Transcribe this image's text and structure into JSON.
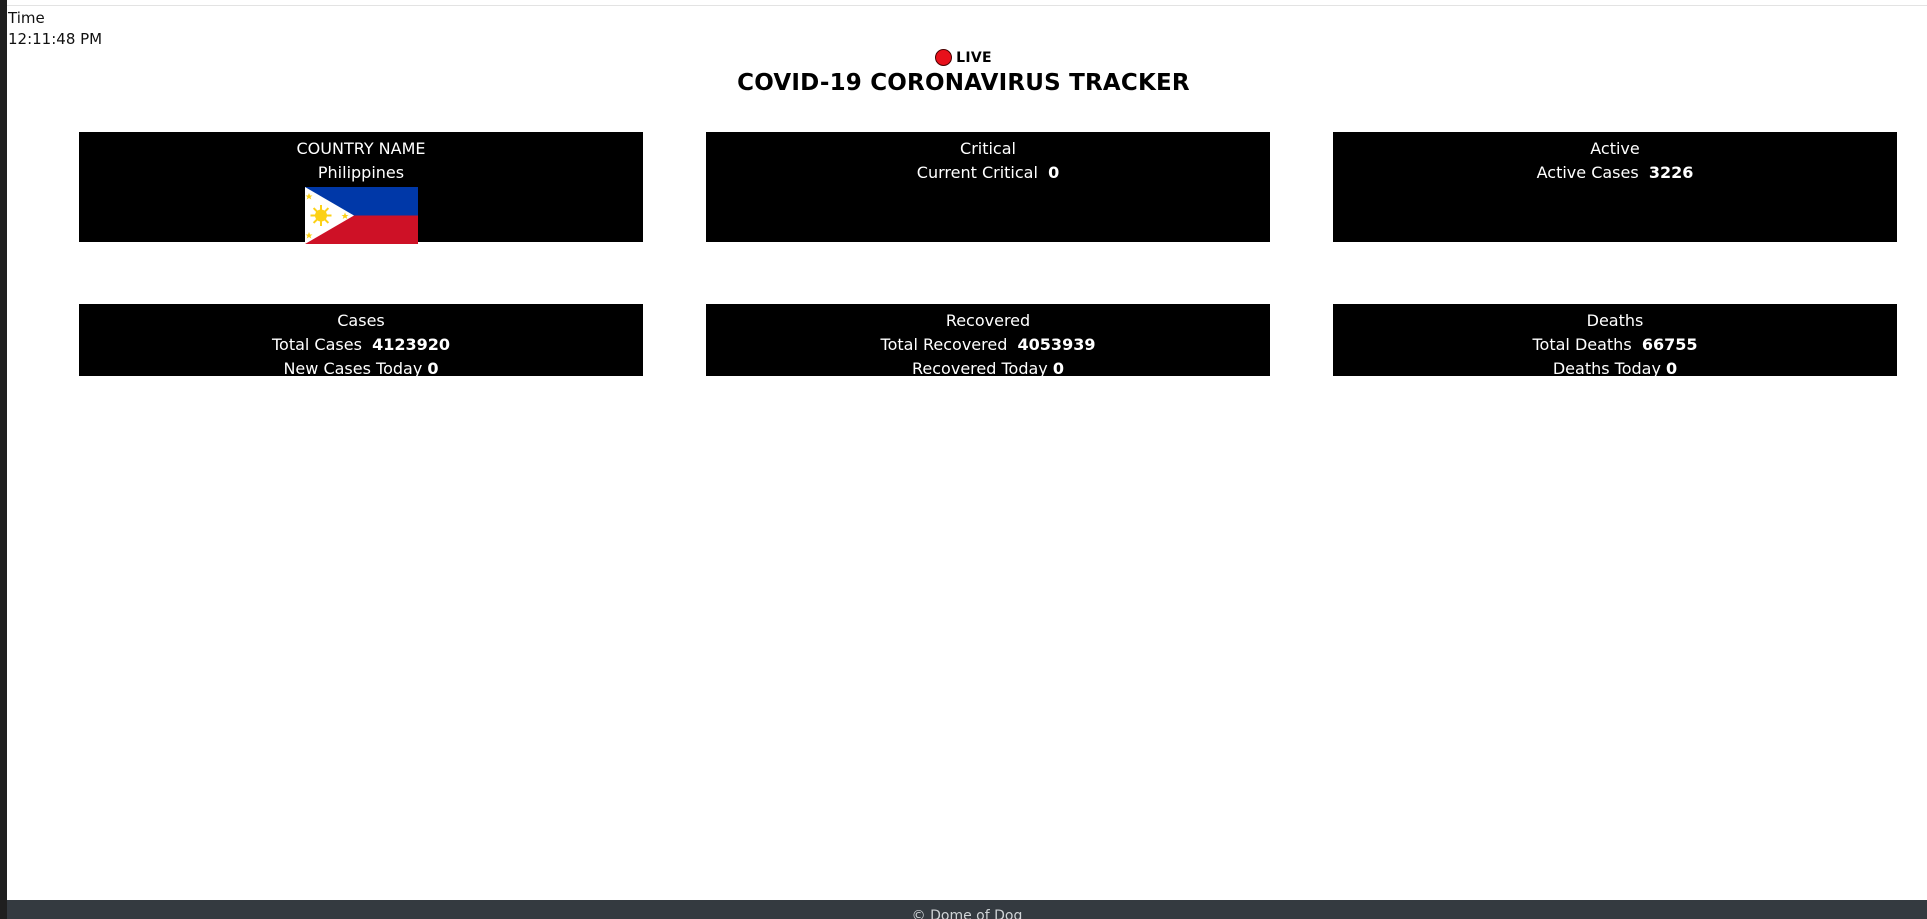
{
  "header": {
    "time_label": "Time",
    "time_value": "12:11:48 PM",
    "live_label": "LIVE",
    "title": "COVID-19 CORONAVIRUS TRACKER"
  },
  "colors": {
    "live_dot": "#e8101b",
    "card_bg": "#000000",
    "footer_bg": "#343a40"
  },
  "country_card": {
    "heading": "COUNTRY NAME",
    "country": "Philippines",
    "flag_icon": "philippines-flag-icon"
  },
  "critical_card": {
    "heading": "Critical",
    "label": "Current Critical",
    "value": "0"
  },
  "active_card": {
    "heading": "Active",
    "label": "Active Cases",
    "value": "3226"
  },
  "cases_card": {
    "heading": "Cases",
    "total_label": "Total Cases",
    "total_value": "4123920",
    "today_label": "New Cases Today",
    "today_value": "0"
  },
  "recovered_card": {
    "heading": "Recovered",
    "total_label": "Total Recovered",
    "total_value": "4053939",
    "today_label": "Recovered Today",
    "today_value": "0"
  },
  "deaths_card": {
    "heading": "Deaths",
    "total_label": "Total Deaths",
    "total_value": "66755",
    "today_label": "Deaths Today",
    "today_value": "0"
  },
  "footer": {
    "text": "© Dome of Dog"
  }
}
